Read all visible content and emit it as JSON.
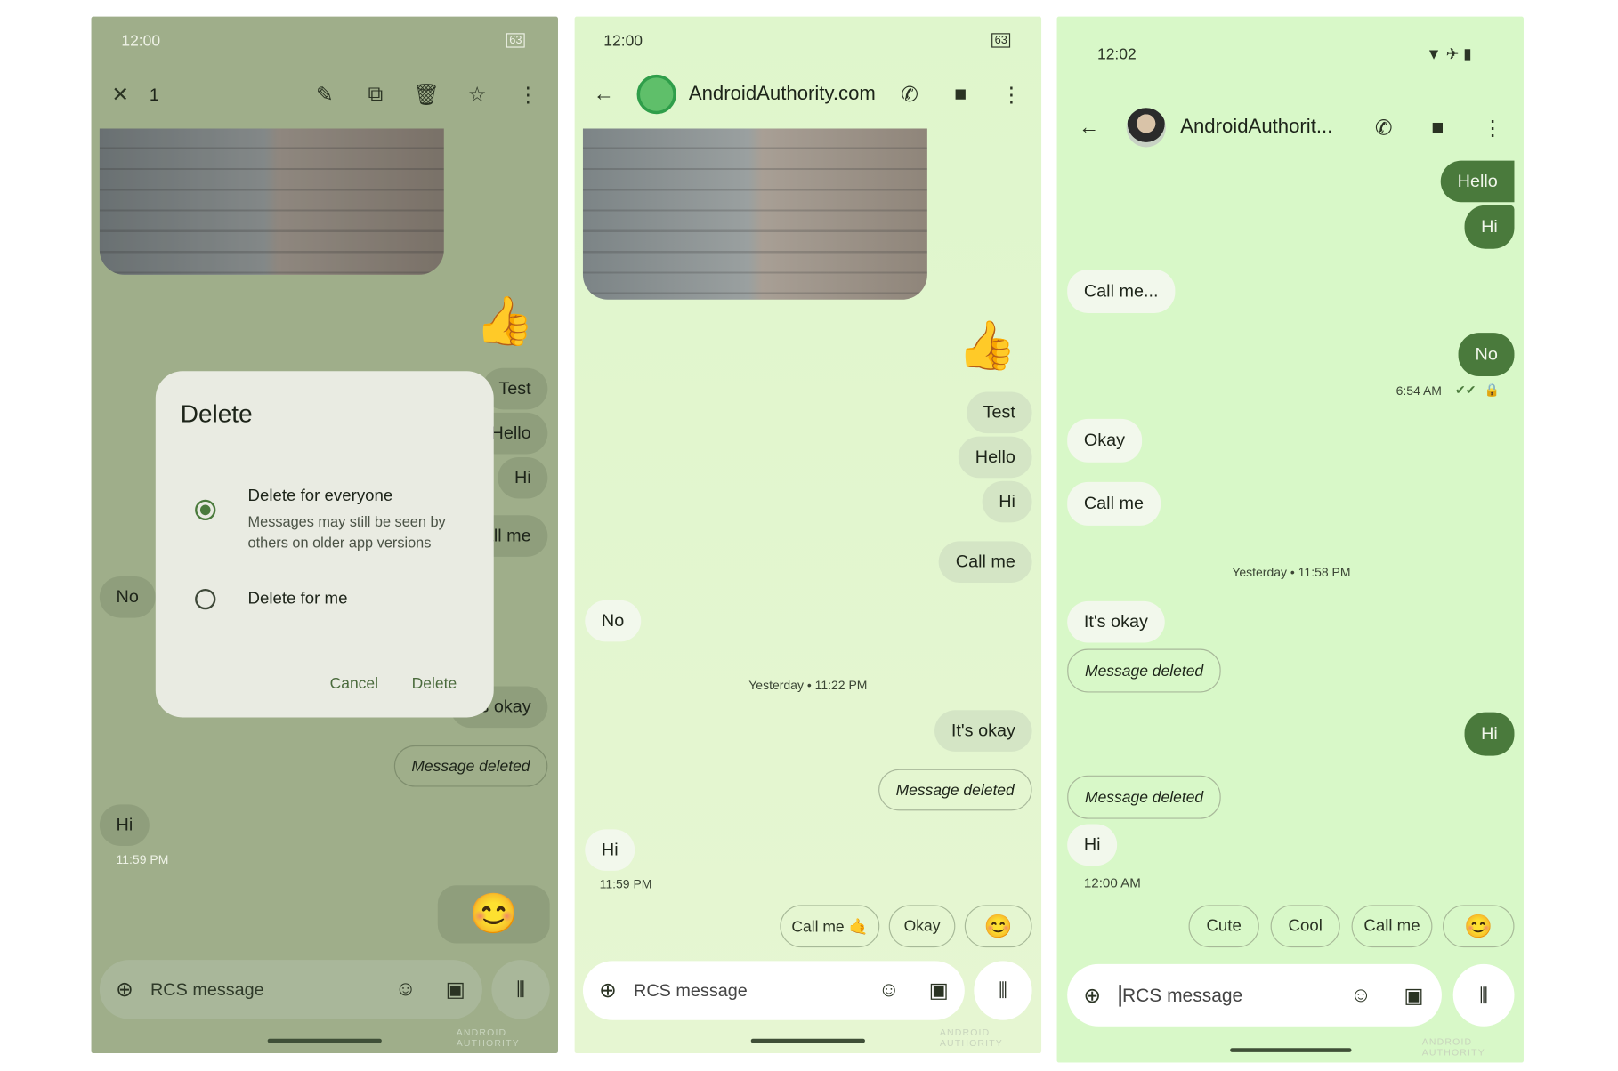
{
  "panel1": {
    "status": {
      "time": "12:00",
      "battery": "63"
    },
    "selection": {
      "count": "1"
    },
    "toolbar_icons": [
      "close-icon",
      "pencil-icon",
      "copy-icon",
      "trash-icon",
      "star-icon",
      "more-vert-icon"
    ],
    "messages": {
      "thumbs": "👍",
      "test": "Test",
      "hello": "Hello",
      "hi": "Hi",
      "callme": "Call me",
      "no": "No",
      "itsokay": "It's okay",
      "deleted": "Message deleted",
      "hi2": "Hi",
      "time": "11:59 PM",
      "sticker": "😊"
    },
    "dialog": {
      "title": "Delete",
      "option1": "Delete for everyone",
      "option1_desc1": "Messages may still be seen by",
      "option1_desc2": "others on older app versions",
      "option2": "Delete for me",
      "selected": "Delete for everyone",
      "cancel": "Cancel",
      "confirm": "Delete"
    },
    "input_placeholder": "RCS message",
    "watermark": "ANDROID AUTHORITY"
  },
  "panel2": {
    "status": {
      "time": "12:00",
      "battery": "63"
    },
    "header": {
      "title": "AndroidAuthority.com"
    },
    "messages": {
      "thumbs": "👍",
      "test": "Test",
      "hello": "Hello",
      "hi": "Hi",
      "callme": "Call me",
      "no": "No",
      "date": "Yesterday • 11:22 PM",
      "itsokay": "It's okay",
      "deleted": "Message deleted",
      "hi2": "Hi",
      "time": "11:59 PM"
    },
    "chips": [
      "Call me 🤙",
      "Okay",
      "😊"
    ],
    "input_placeholder": "RCS message",
    "watermark": "ANDROID AUTHORITY"
  },
  "panel3": {
    "status": {
      "time": "12:02"
    },
    "header": {
      "title": "AndroidAuthorit..."
    },
    "messages": {
      "hello": "Hello",
      "hi": "Hi",
      "callme_dots": "Call me...",
      "no": "No",
      "time1": "6:54 AM",
      "okay": "Okay",
      "callme": "Call me",
      "date": "Yesterday • 11:58 PM",
      "itsokay": "It's okay",
      "deleted1": "Message deleted",
      "hi2": "Hi",
      "deleted2": "Message deleted",
      "hi3": "Hi",
      "time2": "12:00 AM"
    },
    "chips": [
      "Cute",
      "Cool",
      "Call me",
      "😊"
    ],
    "input_placeholder": "RCS message",
    "watermark": "ANDROID AUTHORITY"
  },
  "colors": {
    "accent_dark_green": "#4a7a3c",
    "bg_light_green": "#d8f8c8",
    "dimmed_bg": "#9fae8a"
  }
}
